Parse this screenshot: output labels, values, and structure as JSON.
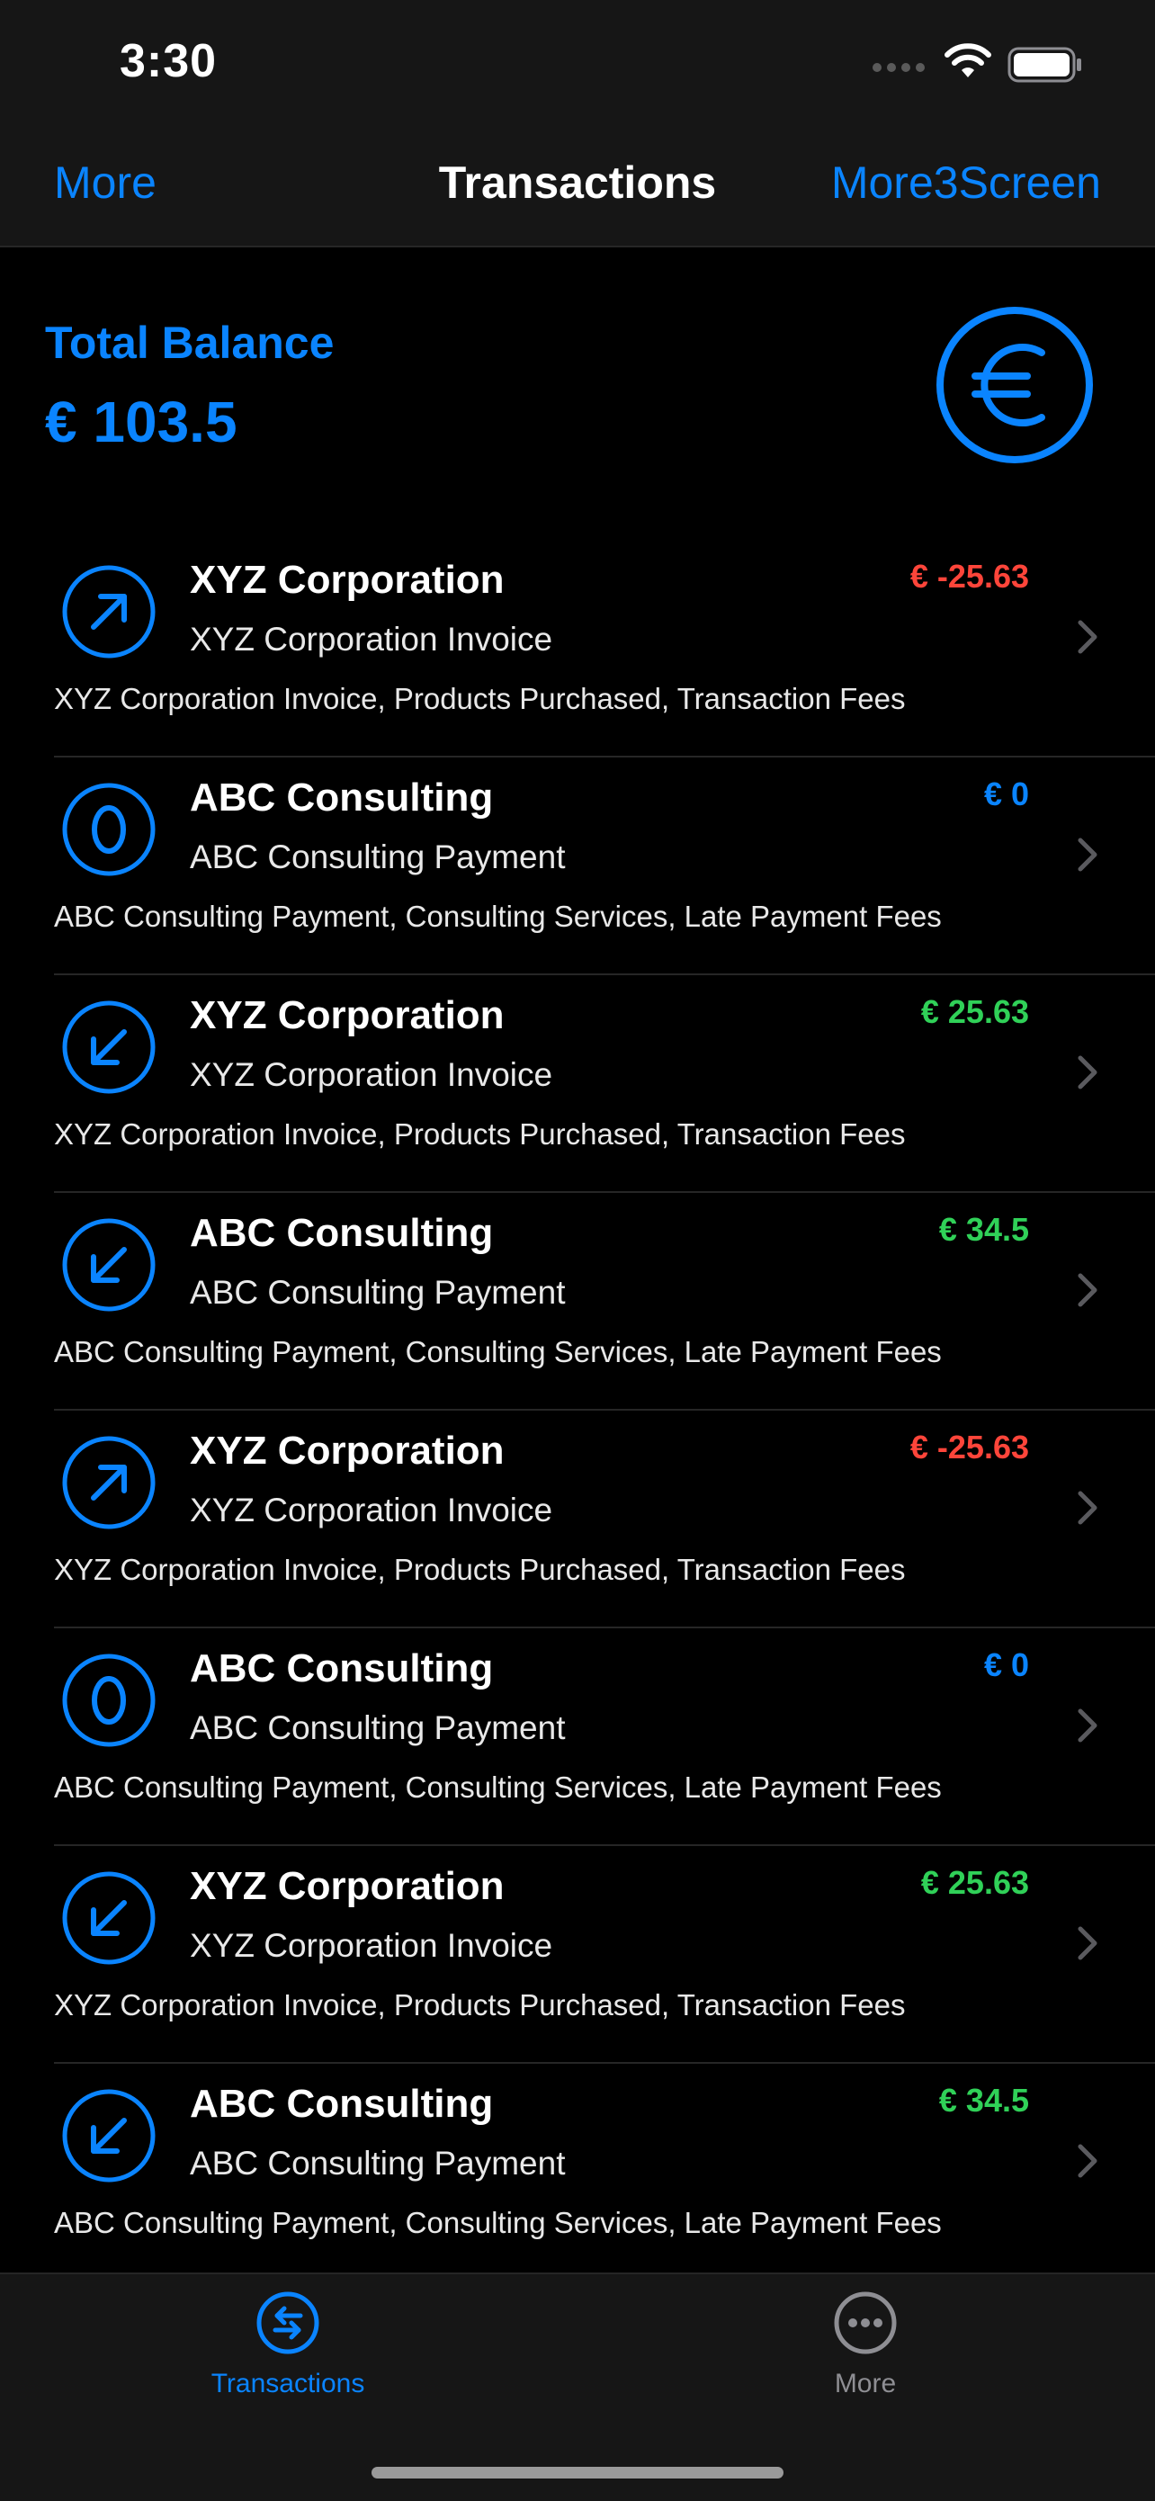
{
  "status_bar": {
    "time": "3:30"
  },
  "nav": {
    "left": "More",
    "title": "Transactions",
    "right": "More3Screen"
  },
  "balance": {
    "label": "Total Balance",
    "value": "€ 103.5",
    "icon": "euro-sign-icon"
  },
  "colors": {
    "accent": "#0a84ff",
    "negative": "#ff453a",
    "positive": "#30d158"
  },
  "transactions": [
    {
      "name": "XYZ Corporation",
      "subtitle": "XYZ Corporation Invoice",
      "details": "XYZ Corporation Invoice, Products Purchased, Transaction Fees",
      "amount": "€ -25.63",
      "kind": "outgoing",
      "icon": "arrow-up-right-icon"
    },
    {
      "name": "ABC Consulting",
      "subtitle": "ABC Consulting Payment",
      "details": "ABC Consulting Payment, Consulting Services, Late Payment Fees",
      "amount": "€ 0",
      "kind": "zero",
      "icon": "zero-icon"
    },
    {
      "name": "XYZ Corporation",
      "subtitle": "XYZ Corporation Invoice",
      "details": "XYZ Corporation Invoice, Products Purchased, Transaction Fees",
      "amount": "€ 25.63",
      "kind": "incoming",
      "icon": "arrow-down-left-icon"
    },
    {
      "name": "ABC Consulting",
      "subtitle": "ABC Consulting Payment",
      "details": "ABC Consulting Payment, Consulting Services, Late Payment Fees",
      "amount": "€ 34.5",
      "kind": "incoming",
      "icon": "arrow-down-left-icon"
    },
    {
      "name": "XYZ Corporation",
      "subtitle": "XYZ Corporation Invoice",
      "details": "XYZ Corporation Invoice, Products Purchased, Transaction Fees",
      "amount": "€ -25.63",
      "kind": "outgoing",
      "icon": "arrow-up-right-icon"
    },
    {
      "name": "ABC Consulting",
      "subtitle": "ABC Consulting Payment",
      "details": "ABC Consulting Payment, Consulting Services, Late Payment Fees",
      "amount": "€ 0",
      "kind": "zero",
      "icon": "zero-icon"
    },
    {
      "name": "XYZ Corporation",
      "subtitle": "XYZ Corporation Invoice",
      "details": "XYZ Corporation Invoice, Products Purchased, Transaction Fees",
      "amount": "€ 25.63",
      "kind": "incoming",
      "icon": "arrow-down-left-icon"
    },
    {
      "name": "ABC Consulting",
      "subtitle": "ABC Consulting Payment",
      "details": "ABC Consulting Payment, Consulting Services, Late Payment Fees",
      "amount": "€ 34.5",
      "kind": "incoming",
      "icon": "arrow-down-left-icon"
    }
  ],
  "tabbar": {
    "tabs": [
      {
        "label": "Transactions",
        "icon": "arrows-exchange-icon",
        "active": true
      },
      {
        "label": "More",
        "icon": "ellipsis-circle-icon",
        "active": false
      }
    ]
  }
}
